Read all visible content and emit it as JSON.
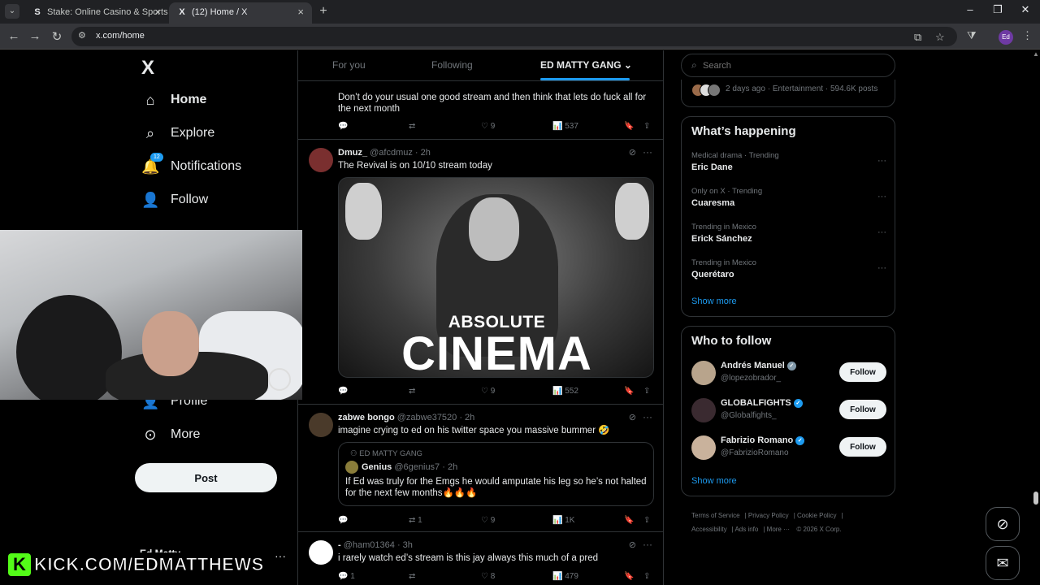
{
  "browser": {
    "tabs": [
      {
        "title": "Stake: Online Casino & Sports B",
        "favicon": "stake-favicon",
        "favicon_glyph": "S"
      },
      {
        "title": "(12) Home / X",
        "favicon": "x-favicon",
        "favicon_glyph": "X"
      }
    ],
    "url": "x.com/home",
    "profile_initials": "Ed"
  },
  "nav": {
    "logo": "X",
    "items": [
      {
        "label": "Home",
        "icon": "home-icon",
        "glyph": "⌂"
      },
      {
        "label": "Explore",
        "icon": "search-icon",
        "glyph": "⌕"
      },
      {
        "label": "Notifications",
        "icon": "bell-icon",
        "glyph": "🔔",
        "badge": "12"
      },
      {
        "label": "Follow",
        "icon": "add-person-icon",
        "glyph": "👤"
      },
      {
        "label": "Profile",
        "icon": "person-icon",
        "glyph": "👤"
      },
      {
        "label": "More",
        "icon": "more-circle-icon",
        "glyph": "⊙"
      }
    ],
    "post_label": "Post",
    "account_name": "Ed Matty"
  },
  "overlay": {
    "kick_letter": "K",
    "kick_text": "KICK.COM/EDMATTHEWS"
  },
  "timeline": {
    "tabs": [
      "For you",
      "Following",
      "ED MATTY GANG"
    ],
    "tweets": [
      {
        "text": "Don’t do your usual one good stream and then think that lets do fuck all for the next month",
        "replies": "",
        "retweets": "",
        "likes": "9",
        "views": "537"
      },
      {
        "name": "Dmuz_",
        "handle": "@afcdmuz · 2h",
        "text": "The Revival is on 10/10 stream today",
        "media_top": "ABSOLUTE",
        "media_bottom": "CINEMA",
        "replies": "",
        "retweets": "",
        "likes": "9",
        "views": "552"
      },
      {
        "name": "zabwe bongo",
        "handle": "@zabwe37520 · 2h",
        "text": "imagine crying to ed on his twitter space you massive bummer 🤣",
        "quote_context": "ED MATTY GANG",
        "quote_name": "Genius",
        "quote_handle": "@6genius7 · 2h",
        "quote_text": "If Ed was truly for the Emgs he would amputate his leg so he’s not halted for the next few months🔥🔥🔥",
        "replies": "",
        "retweets": "1",
        "likes": "9",
        "views": "1K"
      },
      {
        "name": "-",
        "handle": "@ham01364 · 3h",
        "text": "i rarely watch ed’s stream is this jay always this much of a pred",
        "replies": "1",
        "retweets": "",
        "likes": "8",
        "views": "479"
      }
    ]
  },
  "sidebar": {
    "search_placeholder": "Search",
    "top_trend_meta": "2 days ago · Entertainment · 594.6K posts",
    "whats_happening_title": "What’s happening",
    "trends": [
      {
        "context": "Medical drama · Trending",
        "title": "Eric Dane"
      },
      {
        "context": "Only on X · Trending",
        "title": "Cuaresma"
      },
      {
        "context": "Trending in Mexico",
        "title": "Erick Sánchez"
      },
      {
        "context": "Trending in Mexico",
        "title": "Querétaro"
      }
    ],
    "show_more": "Show more",
    "who_to_follow_title": "Who to follow",
    "suggestions": [
      {
        "name": "Andrés Manuel",
        "handle": "@lopezobrador_",
        "verified": "gray",
        "button": "Follow"
      },
      {
        "name": "GLOBALFIGHTS",
        "handle": "@Globalfights_",
        "verified": "blue",
        "button": "Follow"
      },
      {
        "name": "Fabrizio Romano",
        "handle": "@FabrizioRomano",
        "verified": "blue",
        "button": "Follow"
      }
    ],
    "footer_links": [
      "Terms of Service",
      "Privacy Policy",
      "Cookie Policy",
      "Accessibility",
      "Ads info",
      "More ···",
      "© 2026 X Corp."
    ]
  },
  "colors": {
    "background": "#000000",
    "accent": "#1d9bf0",
    "text": "#e7e9ea",
    "muted": "#71767b",
    "border": "#2f3336",
    "kick_green": "#53fc18"
  }
}
